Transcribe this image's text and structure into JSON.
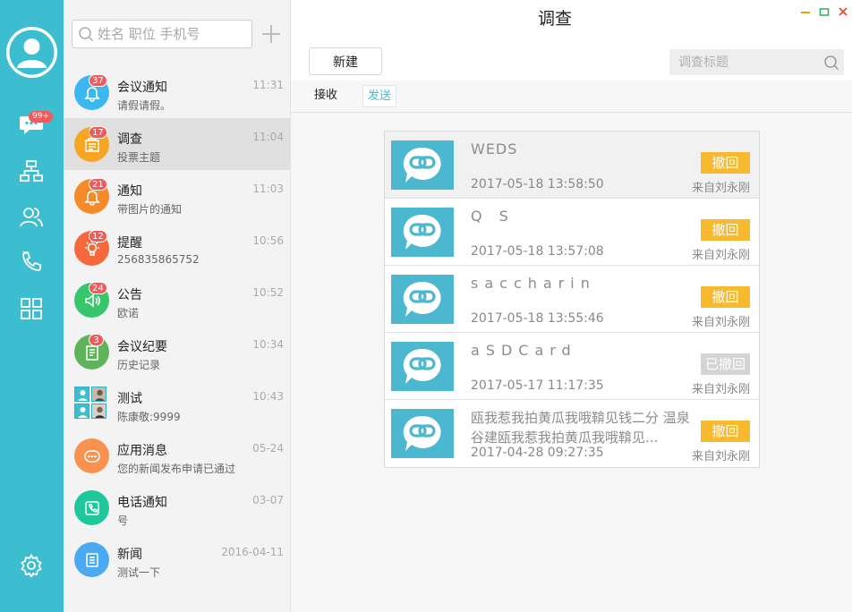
{
  "app": {
    "title": "调查"
  },
  "rail": {
    "unread_badge": "99+"
  },
  "search": {
    "placeholder": "姓名 职位 手机号"
  },
  "sessions": [
    {
      "name": "会议通知",
      "sub": "请假请假。",
      "time": "11:31",
      "badge": "37",
      "color": "#3cb8f0",
      "icon": "bell-icon"
    },
    {
      "name": "调查",
      "sub": "投票主题",
      "time": "11:04",
      "badge": "17",
      "color": "#f6a623",
      "icon": "survey-icon",
      "active": true
    },
    {
      "name": "通知",
      "sub": "带图片的通知",
      "time": "11:03",
      "badge": "21",
      "color": "#f58a2a",
      "icon": "bell-icon"
    },
    {
      "name": "提醒",
      "sub": "256835865752",
      "time": "10:56",
      "badge": "12",
      "color": "#f4683b",
      "icon": "bulb-icon"
    },
    {
      "name": "公告",
      "sub": "欧诺",
      "time": "10:52",
      "badge": "24",
      "color": "#36c66c",
      "icon": "speaker-icon"
    },
    {
      "name": "会议纪要",
      "sub": "历史记录",
      "time": "10:34",
      "badge": "3",
      "color": "#5fb35a",
      "icon": "notes-icon"
    },
    {
      "name": "测试",
      "sub": "陈康敬:9999",
      "time": "10:43",
      "badge": "",
      "color": "",
      "icon": "group-avatar"
    },
    {
      "name": "应用消息",
      "sub": "您的新闻发布申请已通过",
      "time": "05-24",
      "badge": "",
      "color": "#f8924e",
      "icon": "dots-icon"
    },
    {
      "name": "电话通知",
      "sub": "号",
      "time": "03-07",
      "badge": "",
      "color": "#1ec89a",
      "icon": "phone-icon"
    },
    {
      "name": "新闻",
      "sub": "测试一下",
      "time": "2016-04-11",
      "badge": "",
      "color": "#4ba9f2",
      "icon": "news-icon"
    }
  ],
  "toolbar": {
    "new_label": "新建",
    "search_placeholder": "调查标题"
  },
  "tabs": {
    "receive": "接收",
    "send": "发送"
  },
  "surveys": [
    {
      "title": "WEDS",
      "date": "2017-05-18 13:58:50",
      "action": "撤回",
      "from": "来自刘永刚",
      "withdrawn": false
    },
    {
      "title": "Q S",
      "date": "2017-05-18 13:57:08",
      "action": "撤回",
      "from": "来自刘永刚",
      "withdrawn": false
    },
    {
      "title": " saccharin",
      "date": "2017-05-18 13:55:46",
      "action": "撤回",
      "from": "来自刘永刚",
      "withdrawn": false
    },
    {
      "title": " aSDCard",
      "date": "2017-05-17 11:17:35",
      "action": "已撤回",
      "from": "来自刘永刚",
      "withdrawn": true
    },
    {
      "title": "瓯我惹我拍黄瓜我哦鞥见钱二分 温泉谷建瓯我惹我拍黄瓜我哦鞥见...",
      "date": "2017-04-28 09:27:35",
      "action": "撤回",
      "from": "来自刘永刚",
      "withdrawn": false
    }
  ]
}
